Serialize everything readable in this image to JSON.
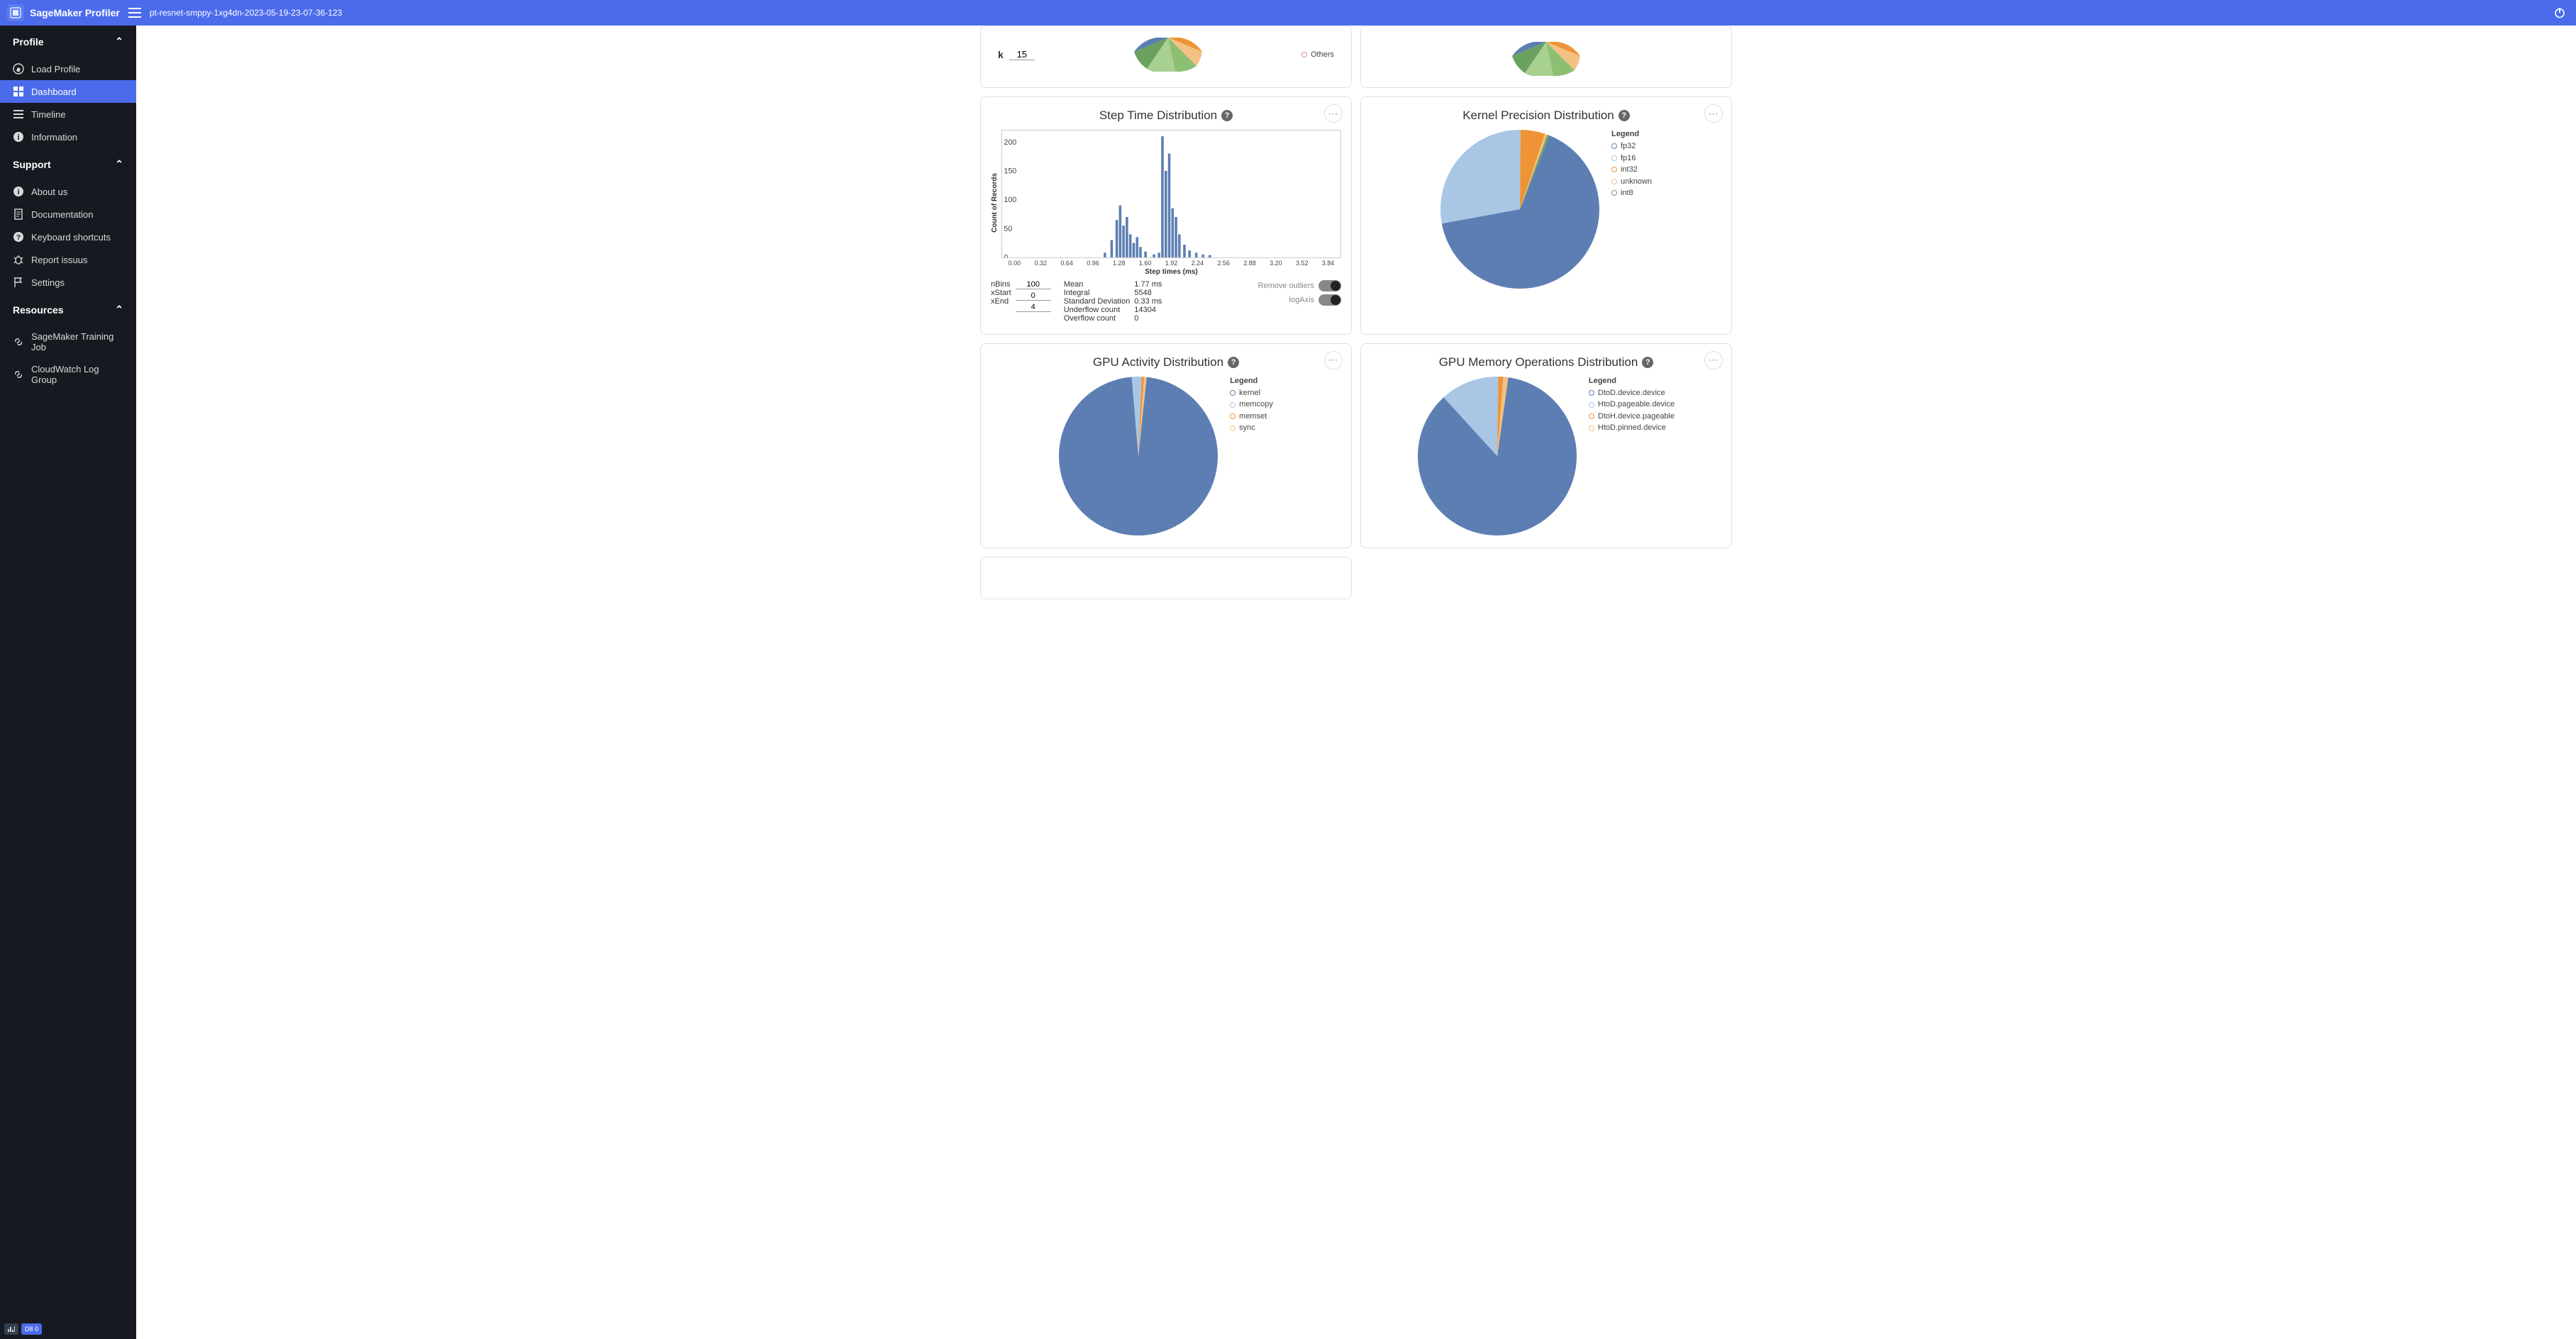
{
  "appTitle": "SageMaker Profiler",
  "jobName": "pt-resnet-smppy-1xg4dn-2023-05-19-23-07-36-123",
  "sidebar": {
    "sections": [
      {
        "title": "Profile",
        "items": [
          {
            "id": "load",
            "label": "Load Profile"
          },
          {
            "id": "dashboard",
            "label": "Dashboard",
            "active": true
          },
          {
            "id": "timeline",
            "label": "Timeline"
          },
          {
            "id": "information",
            "label": "Information"
          }
        ]
      },
      {
        "title": "Support",
        "items": [
          {
            "id": "about",
            "label": "About us"
          },
          {
            "id": "docs",
            "label": "Documentation"
          },
          {
            "id": "keys",
            "label": "Keyboard shortcuts"
          },
          {
            "id": "report",
            "label": "Report issuus"
          },
          {
            "id": "settings",
            "label": "Settings"
          }
        ]
      },
      {
        "title": "Resources",
        "items": [
          {
            "id": "trainingjob",
            "label": "SageMaker Training Job"
          },
          {
            "id": "loggroup",
            "label": "CloudWatch Log Group"
          }
        ]
      }
    ],
    "footerBadge": "D8 0"
  },
  "cards": {
    "topLeft": {
      "kLabel": "k",
      "kValue": "15",
      "legendOther": "Others"
    },
    "stepTime": {
      "title": "Step Time Distribution",
      "ylabel": "Count of Records",
      "xtitle": "Step times (ms)",
      "nBinsLabel": "nBins",
      "nBins": "100",
      "xStartLabel": "xStart",
      "xStart": "0",
      "xEndLabel": "xEnd",
      "xEnd": "4",
      "stats": [
        {
          "label": "Mean",
          "value": "1.77 ms"
        },
        {
          "label": "Integral",
          "value": "5548"
        },
        {
          "label": "Standard Deviation",
          "value": "0.33 ms"
        },
        {
          "label": "Underflow count",
          "value": "14304"
        },
        {
          "label": "Overflow count",
          "value": "0"
        }
      ],
      "toggle1": "Remove outliers",
      "toggle2": "logAxis"
    },
    "kernelPrecision": {
      "title": "Kernel Precision Distribution",
      "legendTitle": "Legend",
      "legend": [
        {
          "label": "fp32",
          "color": "#5c7eb3"
        },
        {
          "label": "fp16",
          "color": "#a9c6e4"
        },
        {
          "label": "int32",
          "color": "#ee9336"
        },
        {
          "label": "unknown",
          "color": "#f2c183"
        },
        {
          "label": "int8",
          "color": "#6aa15f"
        }
      ]
    },
    "gpuActivity": {
      "title": "GPU Activity Distribution",
      "legendTitle": "Legend",
      "legend": [
        {
          "label": "kernel",
          "color": "#5c7eb3"
        },
        {
          "label": "memcopy",
          "color": "#a9c6e4"
        },
        {
          "label": "memset",
          "color": "#ee9336"
        },
        {
          "label": "sync",
          "color": "#f2c183"
        }
      ]
    },
    "gpuMemOps": {
      "title": "GPU Memory Operations Distribution",
      "legendTitle": "Legend",
      "legend": [
        {
          "label": "DtoD.device.device",
          "color": "#5c7eb3"
        },
        {
          "label": "HtoD.pageable.device",
          "color": "#a9c6e4"
        },
        {
          "label": "DtoH.device.pageable",
          "color": "#ee9336"
        },
        {
          "label": "HtoD.pinned.device",
          "color": "#f2c183"
        }
      ]
    }
  },
  "chart_data": [
    {
      "type": "bar",
      "title": "Step Time Distribution",
      "xlabel": "Step times (ms)",
      "ylabel": "Count of Records",
      "ylim": [
        0,
        220
      ],
      "xticks": [
        "0.00",
        "0.32",
        "0.64",
        "0.96",
        "1.28",
        "1.60",
        "1.92",
        "2.24",
        "2.56",
        "2.88",
        "3.20",
        "3.52",
        "3.84"
      ],
      "yticks": [
        0,
        50,
        100,
        150,
        200
      ],
      "categories": [
        1.2,
        1.28,
        1.34,
        1.38,
        1.42,
        1.46,
        1.5,
        1.54,
        1.58,
        1.62,
        1.68,
        1.78,
        1.84,
        1.88,
        1.92,
        1.96,
        2.0,
        2.04,
        2.08,
        2.14,
        2.2,
        2.28,
        2.36,
        2.44
      ],
      "values": [
        8,
        30,
        65,
        90,
        55,
        70,
        40,
        25,
        35,
        18,
        10,
        5,
        8,
        210,
        150,
        180,
        85,
        70,
        40,
        22,
        12,
        8,
        5,
        4
      ]
    },
    {
      "type": "pie",
      "title": "Kernel Precision Distribution",
      "series": [
        {
          "name": "fp32",
          "value": 66
        },
        {
          "name": "fp16",
          "value": 28
        },
        {
          "name": "int32",
          "value": 5
        },
        {
          "name": "unknown",
          "value": 0.5
        },
        {
          "name": "int8",
          "value": 0.5
        }
      ]
    },
    {
      "type": "pie",
      "title": "GPU Activity Distribution",
      "series": [
        {
          "name": "kernel",
          "value": 97
        },
        {
          "name": "memcopy",
          "value": 2
        },
        {
          "name": "memset",
          "value": 0.5
        },
        {
          "name": "sync",
          "value": 0.5
        }
      ]
    },
    {
      "type": "pie",
      "title": "GPU Memory Operations Distribution",
      "series": [
        {
          "name": "DtoD.device.device",
          "value": 86
        },
        {
          "name": "HtoD.pageable.device",
          "value": 12
        },
        {
          "name": "DtoH.device.pageable",
          "value": 1
        },
        {
          "name": "HtoD.pinned.device",
          "value": 1
        }
      ]
    }
  ]
}
